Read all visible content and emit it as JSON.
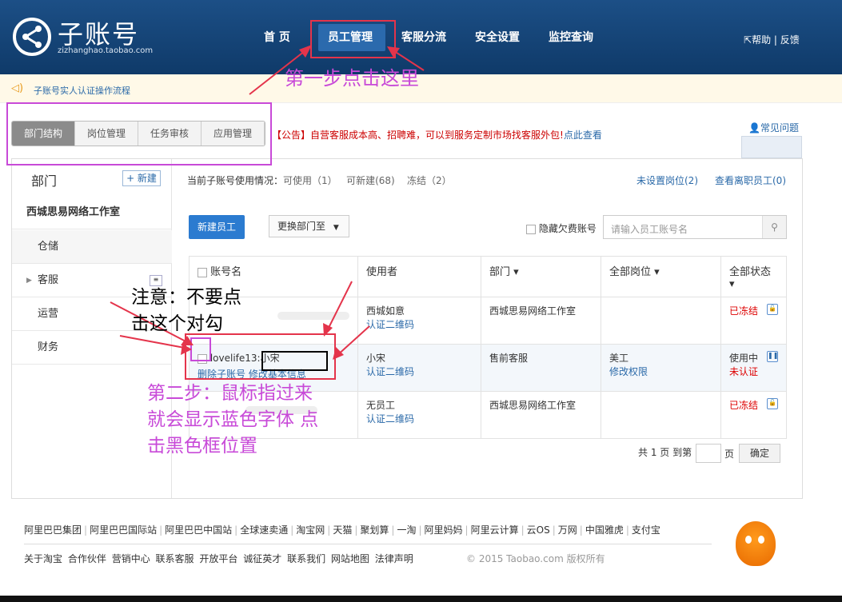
{
  "header": {
    "logo_title": "子账号",
    "logo_sub": "zizhanghao.taobao.com",
    "nav": [
      "首 页",
      "员工管理",
      "客服分流",
      "安全设置",
      "监控查询"
    ],
    "help": "帮助",
    "feedback": "反馈"
  },
  "tip": "子账号实人认证操作流程",
  "tabs": [
    "部门结构",
    "岗位管理",
    "任务审核",
    "应用管理"
  ],
  "notice": {
    "tag": "【公告】",
    "text": "自营客服成本高、招聘难，可以到服务定制市场找客服外包!",
    "link": "点此查看"
  },
  "faq": "常见问题",
  "sidebar": {
    "title": "部门",
    "new": "+ 新建",
    "items": [
      "西城思易网络工作室",
      "仓储",
      "客服",
      "运营",
      "财务"
    ]
  },
  "stats": {
    "label": "当前子账号使用情况：",
    "usable": "可使用（1）",
    "creatable": "可新建(68)",
    "frozen": "冻结（2）",
    "unset": "未设置岗位(2)",
    "resigned": "查看离职员工(0)"
  },
  "toolbar": {
    "new_emp": "新建员工",
    "change_dept": "更换部门至",
    "hide_overdue": "隐藏欠费账号",
    "search_ph": "请输入员工账号名"
  },
  "table": {
    "headers": [
      "账号名",
      "使用者",
      "部门 ▾",
      "全部岗位 ▾",
      "全部状态 ▾"
    ],
    "rows": [
      {
        "account": "",
        "user": "西城如意",
        "qr": "认证二维码",
        "dept": "西城思易网络工作室",
        "role": "",
        "role_link": "",
        "status": "已冻结",
        "status2": ""
      },
      {
        "account": "lovelife13:小宋",
        "del": "删除子账号",
        "edit": "修改基本信息",
        "user": "小宋",
        "qr": "认证二维码",
        "dept": "售前客服",
        "role": "美工",
        "role_link": "修改权限",
        "status": "使用中",
        "status2": "未认证"
      },
      {
        "account": "",
        "user": "无员工",
        "qr": "认证二维码",
        "dept": "西城思易网络工作室",
        "role": "",
        "role_link": "",
        "status": "已冻结",
        "status2": ""
      }
    ]
  },
  "pager": {
    "text": "共 1 页 到第",
    "page": "页",
    "ok": "确定"
  },
  "footer": {
    "links1": [
      "阿里巴巴集团",
      "阿里巴巴国际站",
      "阿里巴巴中国站",
      "全球速卖通",
      "淘宝网",
      "天猫",
      "聚划算",
      "一淘",
      "阿里妈妈",
      "阿里云计算",
      "云OS",
      "万网",
      "中国雅虎",
      "支付宝"
    ],
    "links2": [
      "关于淘宝",
      "合作伙伴",
      "营销中心",
      "联系客服",
      "开放平台",
      "诚征英才",
      "联系我们",
      "网站地图",
      "法律声明"
    ],
    "copyright": "© 2015 Taobao.com 版权所有"
  },
  "annotations": {
    "step1": "第一步点击这里",
    "warn1": "注意：不要点",
    "warn2": "击这个对勾",
    "step2a": "第二步：鼠标指过来",
    "step2b": "就会显示蓝色字体 点",
    "step2c": "击黑色框位置"
  },
  "colors": {
    "header": "#1c4f86",
    "accent": "#2a69a8",
    "annotation_red": "#e4344b",
    "annotation_magenta": "#c84ad8"
  }
}
